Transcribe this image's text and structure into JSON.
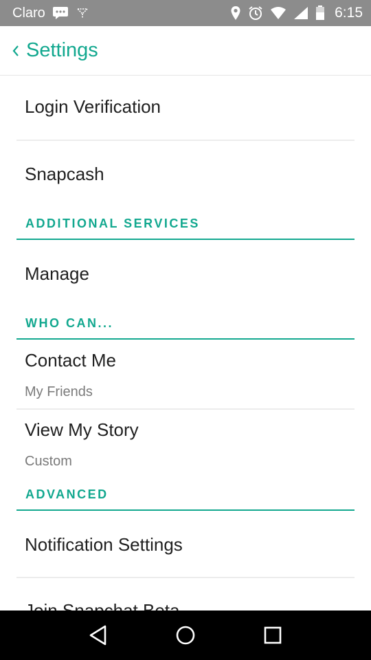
{
  "status_bar": {
    "carrier": "Claro",
    "time": "6:15",
    "icons": [
      "message-icon",
      "signal-sync-icon",
      "location-icon",
      "alarm-icon",
      "wifi-icon",
      "cell-signal-icon",
      "battery-icon"
    ]
  },
  "header": {
    "title": "Settings"
  },
  "items": {
    "login_verification": "Login Verification",
    "snapcash": "Snapcash",
    "manage": "Manage",
    "contact_me": "Contact Me",
    "contact_me_value": "My Friends",
    "view_my_story": "View My Story",
    "view_my_story_value": "Custom",
    "notification_settings": "Notification Settings",
    "join_beta": "Join Snapchat Beta"
  },
  "sections": {
    "additional_services": "ADDITIONAL SERVICES",
    "who_can": "WHO CAN...",
    "advanced": "ADVANCED"
  },
  "colors": {
    "accent": "#12a88f",
    "status_bar": "#8c8c8c",
    "nav_bar": "#000000"
  },
  "nav_bar": {
    "icons": [
      "back-triangle-icon",
      "home-circle-icon",
      "recents-square-icon"
    ]
  }
}
